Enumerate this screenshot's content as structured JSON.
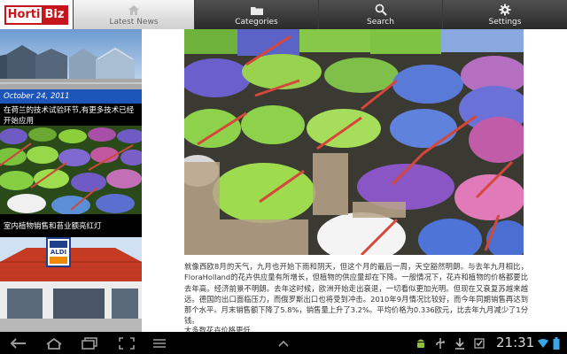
{
  "app": {
    "logo_text_a": "Horti",
    "logo_text_b": "Biz"
  },
  "tabs": [
    {
      "label": "Latest News",
      "icon": "home-icon"
    },
    {
      "label": "Categories",
      "icon": "folder-icon"
    },
    {
      "label": "Search",
      "icon": "search-icon"
    },
    {
      "label": "Settings",
      "icon": "gear-icon"
    }
  ],
  "news": [
    {
      "date": "October 24, 2011",
      "title": "在荷兰的技术试验环节,有更多技术已经开始应用"
    },
    {
      "title": "室内植物销售和苔业额亮红灯"
    },
    {
      "sign": "ALDI"
    }
  ],
  "article": {
    "body": "就像西欧8月的天气，九月也开始下雨和阴天，但这个月的最后一周，天空豁然明朗。与去年九月相比，FloraHolland的花卉供应量有所增长，但植物的供应量却在下降。一般情况下，花卉和植物的价格都要比去年高。经济前景不明朗。去年这时候，欧洲开始走出衰退，一切看似更加光明。但现在又衰复苏越来越远。德国的出口面临压力，而俄罗斯出口也将受到冲击。2010年9月情况比较好，而今年同期销售再达到那个水平。月末销售额下降了5.8%，销售量上升了3.2%。平均价格为0.336欧元，比去年九月减少了1分钱。",
    "subhead": "大多数花卉价格更低"
  },
  "status": {
    "time": "21:31"
  }
}
